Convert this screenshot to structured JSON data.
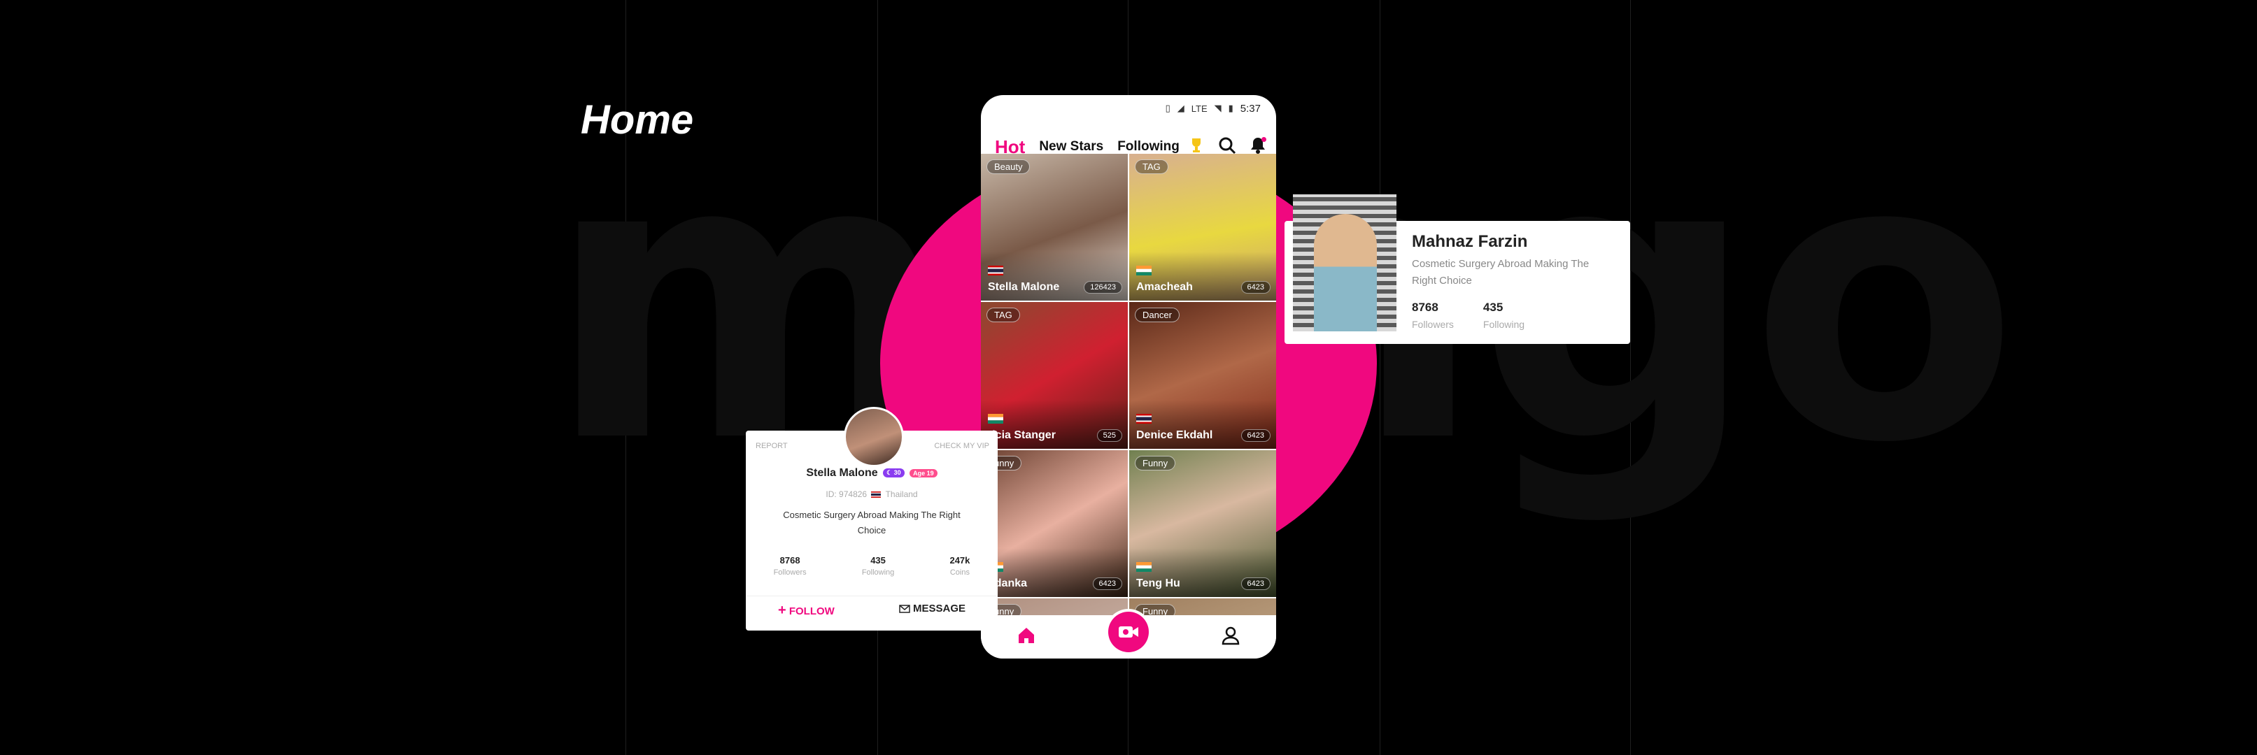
{
  "page": {
    "title": "Home",
    "background_word": "mango"
  },
  "colors": {
    "accent": "#f0087f",
    "background": "#000000"
  },
  "status_bar": {
    "time": "5:37",
    "network": "LTE"
  },
  "tabs": [
    {
      "label": "Hot",
      "active": true
    },
    {
      "label": "New Stars",
      "active": false
    },
    {
      "label": "Following",
      "active": false
    }
  ],
  "nav_icons": [
    "trophy-icon",
    "search-icon",
    "bell-icon"
  ],
  "feed": [
    {
      "name": "Stella Malone",
      "tag": "Beauty",
      "count": "126423",
      "flag": "thailand"
    },
    {
      "name": "Amacheah",
      "tag": "TAG",
      "count": "6423",
      "flag": "india"
    },
    {
      "name": "ricia Stanger",
      "tag": "TAG",
      "count": "525",
      "flag": "india"
    },
    {
      "name": "Denice Ekdahl",
      "tag": "Dancer",
      "count": "6423",
      "flag": "thailand"
    },
    {
      "name": "udanka",
      "tag": "unny",
      "count": "6423",
      "flag": "india"
    },
    {
      "name": "Teng Hu",
      "tag": "Funny",
      "count": "6423",
      "flag": "india"
    },
    {
      "name": "",
      "tag": "unny",
      "count": "",
      "flag": ""
    },
    {
      "name": "",
      "tag": "Funny",
      "count": "",
      "flag": ""
    }
  ],
  "bottom_bar": {
    "items": [
      "home-icon",
      "camera-icon",
      "profile-icon"
    ]
  },
  "profile_card": {
    "report_label": "REPORT",
    "vip_label": "CHECK MY VIP",
    "name": "Stella Malone",
    "badge_level": "30",
    "badge_age": "Age 19",
    "id_text": "ID: 974826",
    "country": "Thailand",
    "bio": "Cosmetic Surgery Abroad Making The Right Choice",
    "stats": [
      {
        "value": "8768",
        "label": "Followers"
      },
      {
        "value": "435",
        "label": "Following"
      },
      {
        "value": "247k",
        "label": "Coins"
      }
    ],
    "follow_label": "FOLLOW",
    "message_label": "MESSAGE"
  },
  "right_card": {
    "name": "Mahnaz Farzin",
    "bio": "Cosmetic Surgery Abroad Making The Right Choice",
    "stats": [
      {
        "value": "8768",
        "label": "Followers"
      },
      {
        "value": "435",
        "label": "Following"
      }
    ]
  }
}
